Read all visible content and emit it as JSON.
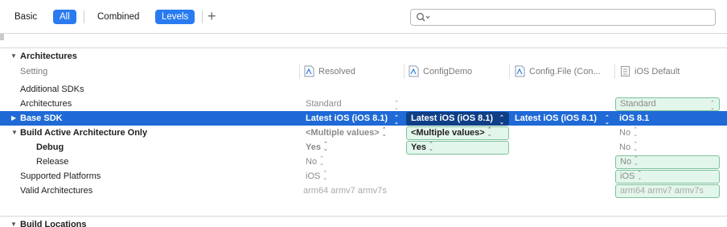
{
  "toolbar": {
    "basic": "Basic",
    "all": "All",
    "combined": "Combined",
    "levels": "Levels",
    "add": "+"
  },
  "sections": {
    "architectures": "Architectures",
    "build_locations": "Build Locations"
  },
  "columns": {
    "setting": "Setting",
    "resolved": "Resolved",
    "config_demo": "ConfigDemo",
    "config_file": "Config.File (Con...",
    "ios_default": "iOS Default"
  },
  "rows": {
    "additional_sdks": {
      "name": "Additional SDKs"
    },
    "architectures": {
      "name": "Architectures",
      "resolved": "Standard",
      "ios_default": "Standard"
    },
    "base_sdk": {
      "name": "Base SDK",
      "resolved": "Latest iOS (iOS 8.1)",
      "config_demo": "Latest iOS (iOS 8.1)",
      "config_file": "Latest iOS (iOS 8.1)",
      "ios_default": "iOS 8.1"
    },
    "build_active_arch": {
      "name": "Build Active Architecture Only",
      "resolved": "<Multiple values>",
      "config_demo": "<Multiple values>",
      "ios_default": "No"
    },
    "debug": {
      "name": "Debug",
      "resolved": "Yes",
      "config_demo": "Yes",
      "ios_default": "No"
    },
    "release": {
      "name": "Release",
      "resolved": "No",
      "ios_default": "No"
    },
    "supported_platforms": {
      "name": "Supported Platforms",
      "resolved": "iOS",
      "ios_default": "iOS"
    },
    "valid_architectures": {
      "name": "Valid Architectures",
      "resolved": "arm64 armv7 armv7s",
      "ios_default": "arm64 armv7 armv7s"
    }
  },
  "colors": {
    "selection": "#1f6ad6",
    "toolbar_active": "#2a7bf0",
    "default_highlight": "#e3f6eb",
    "default_border": "#7cc29b"
  }
}
